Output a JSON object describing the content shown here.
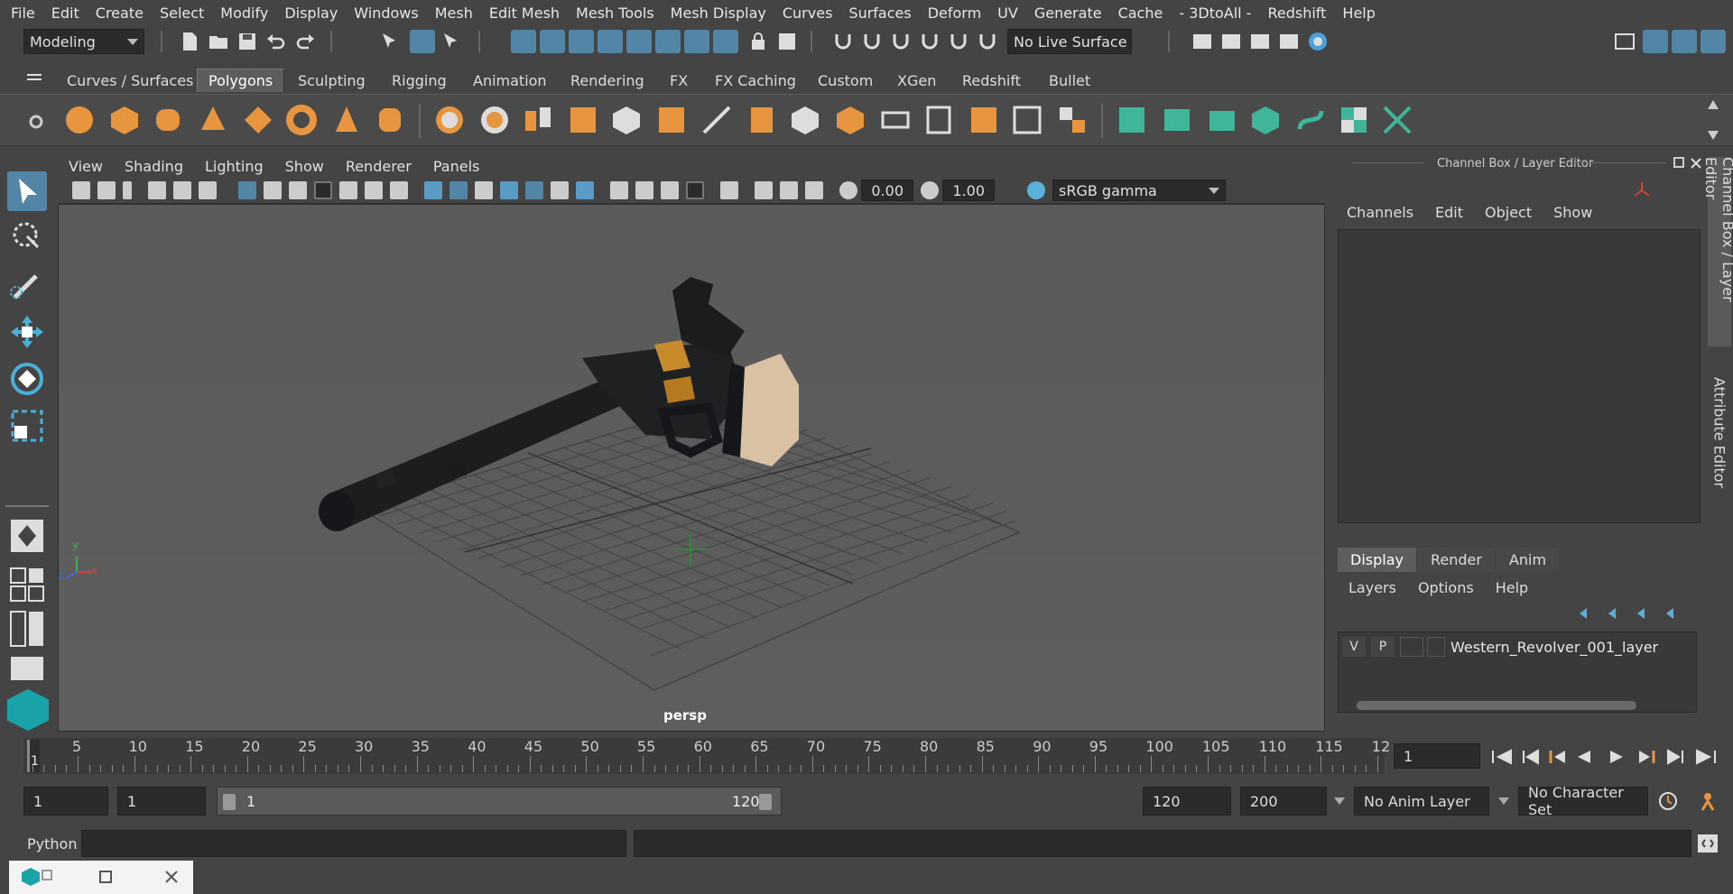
{
  "menubar": [
    "File",
    "Edit",
    "Create",
    "Select",
    "Modify",
    "Display",
    "Windows",
    "Mesh",
    "Edit Mesh",
    "Mesh Tools",
    "Mesh Display",
    "Curves",
    "Surfaces",
    "Deform",
    "UV",
    "Generate",
    "Cache",
    "- 3DtoAll -",
    "Redshift",
    "Help"
  ],
  "status": {
    "workspace": "Modeling",
    "live_surface": "No Live Surface"
  },
  "shelf_tabs": [
    "Curves / Surfaces",
    "Polygons",
    "Sculpting",
    "Rigging",
    "Animation",
    "Rendering",
    "FX",
    "FX Caching",
    "Custom",
    "XGen",
    "Redshift",
    "Bullet"
  ],
  "active_shelf_tab": "Polygons",
  "panel_menu": [
    "View",
    "Shading",
    "Lighting",
    "Show",
    "Renderer",
    "Panels"
  ],
  "panel_toolbar": {
    "exposure": "0.00",
    "gamma": "1.00",
    "colorspace": "sRGB gamma"
  },
  "viewport": {
    "camera_label": "persp",
    "axis_x": "x",
    "axis_y": "y",
    "axis_z": "z"
  },
  "channel_box": {
    "title": "Channel Box / Layer Editor",
    "menu": [
      "Channels",
      "Edit",
      "Object",
      "Show"
    ],
    "tabs": [
      "Display",
      "Render",
      "Anim"
    ],
    "active_tab": "Display",
    "layer_menu": [
      "Layers",
      "Options",
      "Help"
    ],
    "layer": {
      "v": "V",
      "p": "P",
      "name": "Western_Revolver_001_layer"
    }
  },
  "side_tabs": [
    "Channel Box / Layer Editor",
    "Attribute Editor"
  ],
  "timeslider": {
    "ticks": [
      "5",
      "10",
      "15",
      "20",
      "25",
      "30",
      "35",
      "40",
      "45",
      "50",
      "55",
      "60",
      "65",
      "70",
      "75",
      "80",
      "85",
      "90",
      "95",
      "100",
      "105",
      "110",
      "115",
      "12"
    ],
    "current_frame_marker": "1",
    "current_frame_field": "1"
  },
  "range": {
    "start": "1",
    "playback_start": "1",
    "slider_start": "1",
    "slider_end": "120",
    "playback_end": "120",
    "end": "200",
    "anim_layer": "No Anim Layer",
    "character_set": "No Character Set"
  },
  "command": {
    "language": "Python"
  }
}
